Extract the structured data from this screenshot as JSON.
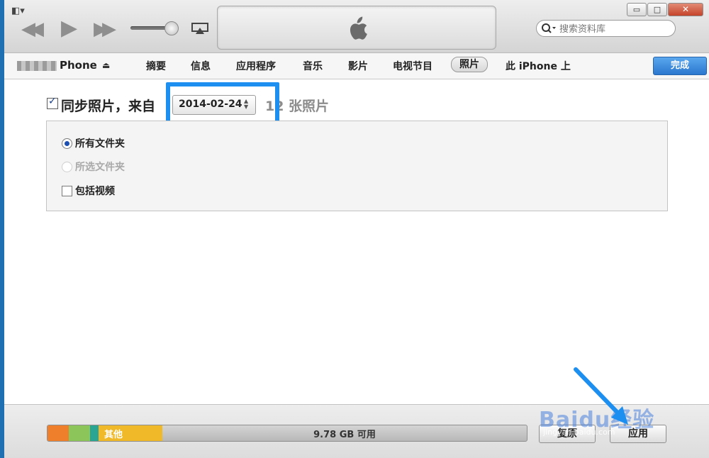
{
  "colors": {
    "accent": "#1d8ff0",
    "done_button": "#2a77cf",
    "storage_other": "#f0b92a"
  },
  "toolbar": {
    "menu_icon": "window-menu-icon"
  },
  "search": {
    "placeholder": "搜索资料库"
  },
  "window_controls": {
    "minimize": "▭",
    "maximize": "□",
    "close": "✕"
  },
  "device": {
    "name": "Phone",
    "eject_symbol": "⏏"
  },
  "tabs": [
    {
      "label": "摘要"
    },
    {
      "label": "信息"
    },
    {
      "label": "应用程序"
    },
    {
      "label": "音乐"
    },
    {
      "label": "影片"
    },
    {
      "label": "电视节目"
    },
    {
      "label": "照片",
      "selected": true
    },
    {
      "label": "此 iPhone 上"
    }
  ],
  "done_label": "完成",
  "sync": {
    "label": "同步照片，来自",
    "date_value": "2014-02-24",
    "count": "12 张照片"
  },
  "options": {
    "all_folders": "所有文件夹",
    "selected_folders": "所选文件夹",
    "include_videos": "包括视频"
  },
  "storage": {
    "other_label": "其他",
    "free_label": "9.78 GB 可用"
  },
  "buttons": {
    "revert": "复原",
    "apply": "应用"
  },
  "watermark": {
    "text": "Baidu经验",
    "sub": "jingyan.baidu.com"
  }
}
